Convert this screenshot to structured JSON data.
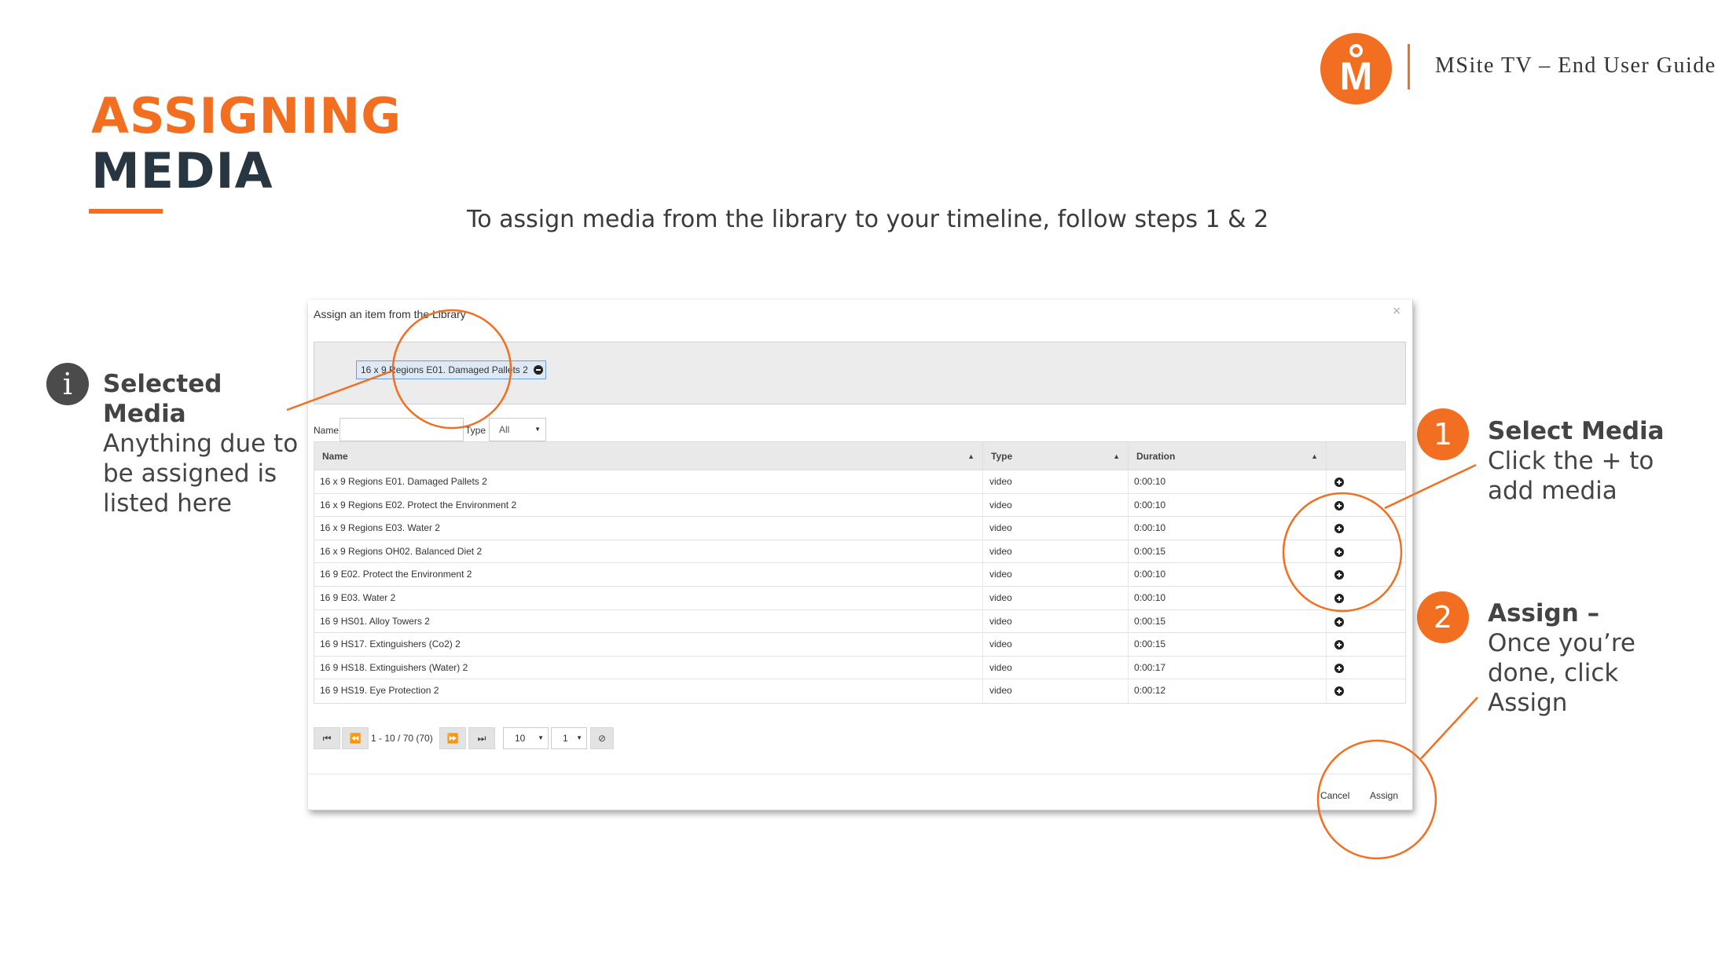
{
  "header": {
    "logo_letter": "M",
    "guide_title": "MSite TV – End User Guide"
  },
  "page": {
    "title_line1": "ASSIGNING",
    "title_line2": "MEDIA",
    "subtitle": "To assign media from the library to your timeline, follow steps 1 & 2"
  },
  "annotations": {
    "info_icon_glyph": "i",
    "selected_heading": "Selected Media",
    "selected_body": "Anything due to be assigned is listed here",
    "step1_number": "1",
    "step1_bold": "Select Media",
    "step1_body": " Click the + to add media",
    "step2_number": "2",
    "step2_bold": "Assign –",
    "step2_body": "Once you’re done, click Assign"
  },
  "modal": {
    "title": "Assign an item from the Library",
    "close": "×",
    "selected_item": "16 x 9 Regions E01. Damaged Pallets 2",
    "filter": {
      "name_label": "Name",
      "name_value": "",
      "type_label": "Type",
      "type_value": "All"
    },
    "table": {
      "headers": {
        "name": "Name",
        "type": "Type",
        "duration": "Duration"
      },
      "rows": [
        {
          "name": "16 x 9 Regions E01. Damaged Pallets 2",
          "type": "video",
          "duration": "0:00:10"
        },
        {
          "name": "16 x 9 Regions E02. Protect the Environment 2",
          "type": "video",
          "duration": "0:00:10"
        },
        {
          "name": "16 x 9 Regions E03. Water 2",
          "type": "video",
          "duration": "0:00:10"
        },
        {
          "name": "16 x 9 Regions OH02. Balanced Diet 2",
          "type": "video",
          "duration": "0:00:15"
        },
        {
          "name": "16 9 E02. Protect the Environment 2",
          "type": "video",
          "duration": "0:00:10"
        },
        {
          "name": "16 9 E03. Water 2",
          "type": "video",
          "duration": "0:00:10"
        },
        {
          "name": "16 9 HS01. Alloy Towers 2",
          "type": "video",
          "duration": "0:00:15"
        },
        {
          "name": "16 9 HS17. Extinguishers (Co2) 2",
          "type": "video",
          "duration": "0:00:15"
        },
        {
          "name": "16 9 HS18. Extinguishers (Water) 2",
          "type": "video",
          "duration": "0:00:17"
        },
        {
          "name": "16 9 HS19. Eye Protection 2",
          "type": "video",
          "duration": "0:00:12"
        }
      ]
    },
    "pager": {
      "info": "1 - 10 / 70 (70)",
      "page_size": "10",
      "page": "1"
    },
    "buttons": {
      "cancel": "Cancel",
      "assign": "Assign"
    }
  },
  "colors": {
    "accent": "#f26f21",
    "dark": "#283642",
    "info_icon": "#4b4b4b"
  }
}
